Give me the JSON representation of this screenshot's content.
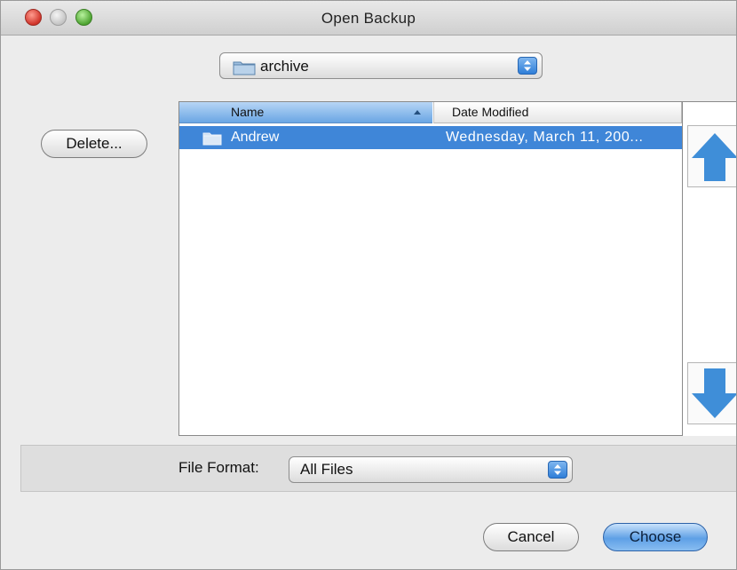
{
  "window": {
    "title": "Open Backup"
  },
  "location": {
    "selected": "archive",
    "icon": "folder-icon"
  },
  "actions": {
    "delete_label": "Delete..."
  },
  "file_list": {
    "columns": [
      "Name",
      "Date Modified"
    ],
    "sort_column": "Name",
    "rows": [
      {
        "name": "Andrew",
        "date_modified": "Wednesday, March 11, 200...",
        "selected": true,
        "icon": "folder-icon"
      }
    ]
  },
  "scroll": {
    "up_icon": "arrow-up-icon",
    "down_icon": "arrow-down-icon"
  },
  "file_format": {
    "label": "File Format:",
    "selected": "All Files"
  },
  "footer": {
    "cancel_label": "Cancel",
    "choose_label": "Choose"
  },
  "colors": {
    "selection": "#3f86d8",
    "accent": "#2f7ed8",
    "arrow": "#3f8ed8"
  }
}
